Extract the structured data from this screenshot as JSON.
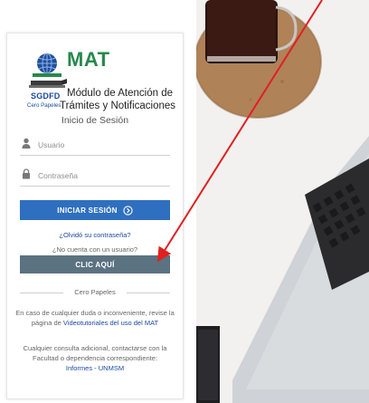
{
  "brand": {
    "acronym": "MAT",
    "org": "SGDFD",
    "tagline": "Cero Papeles",
    "title_line1": "Módulo de Atención de",
    "title_line2": "Trámites y Notificaciones",
    "accent": "#27894d",
    "blue": "#1b4aa3"
  },
  "login": {
    "heading": "Inicio de Sesión",
    "username_placeholder": "Usuario",
    "password_placeholder": "Contraseña",
    "submit_label": "INICIAR SESIÓN",
    "forgot_label": "¿Olvidó su contraseña?",
    "no_account_label": "¿No cuenta con un usuario?",
    "register_label": "CLIC AQUÍ",
    "button_color": "#2f6fbf",
    "register_color": "#5b7281"
  },
  "footer": {
    "separator": "Cero Papeles",
    "help_text_1": "En caso de cualquier duda o inconveniente, revise la página de",
    "help_link": "Videotutoriales del uso del MAT",
    "help_text_2": "Cualquier consulta adicional, contactarse con la Facultad o dependencia correspondiente:",
    "contact_link": "Informes - UNMSM"
  },
  "annotation": {
    "arrow_color": "#e02020"
  }
}
